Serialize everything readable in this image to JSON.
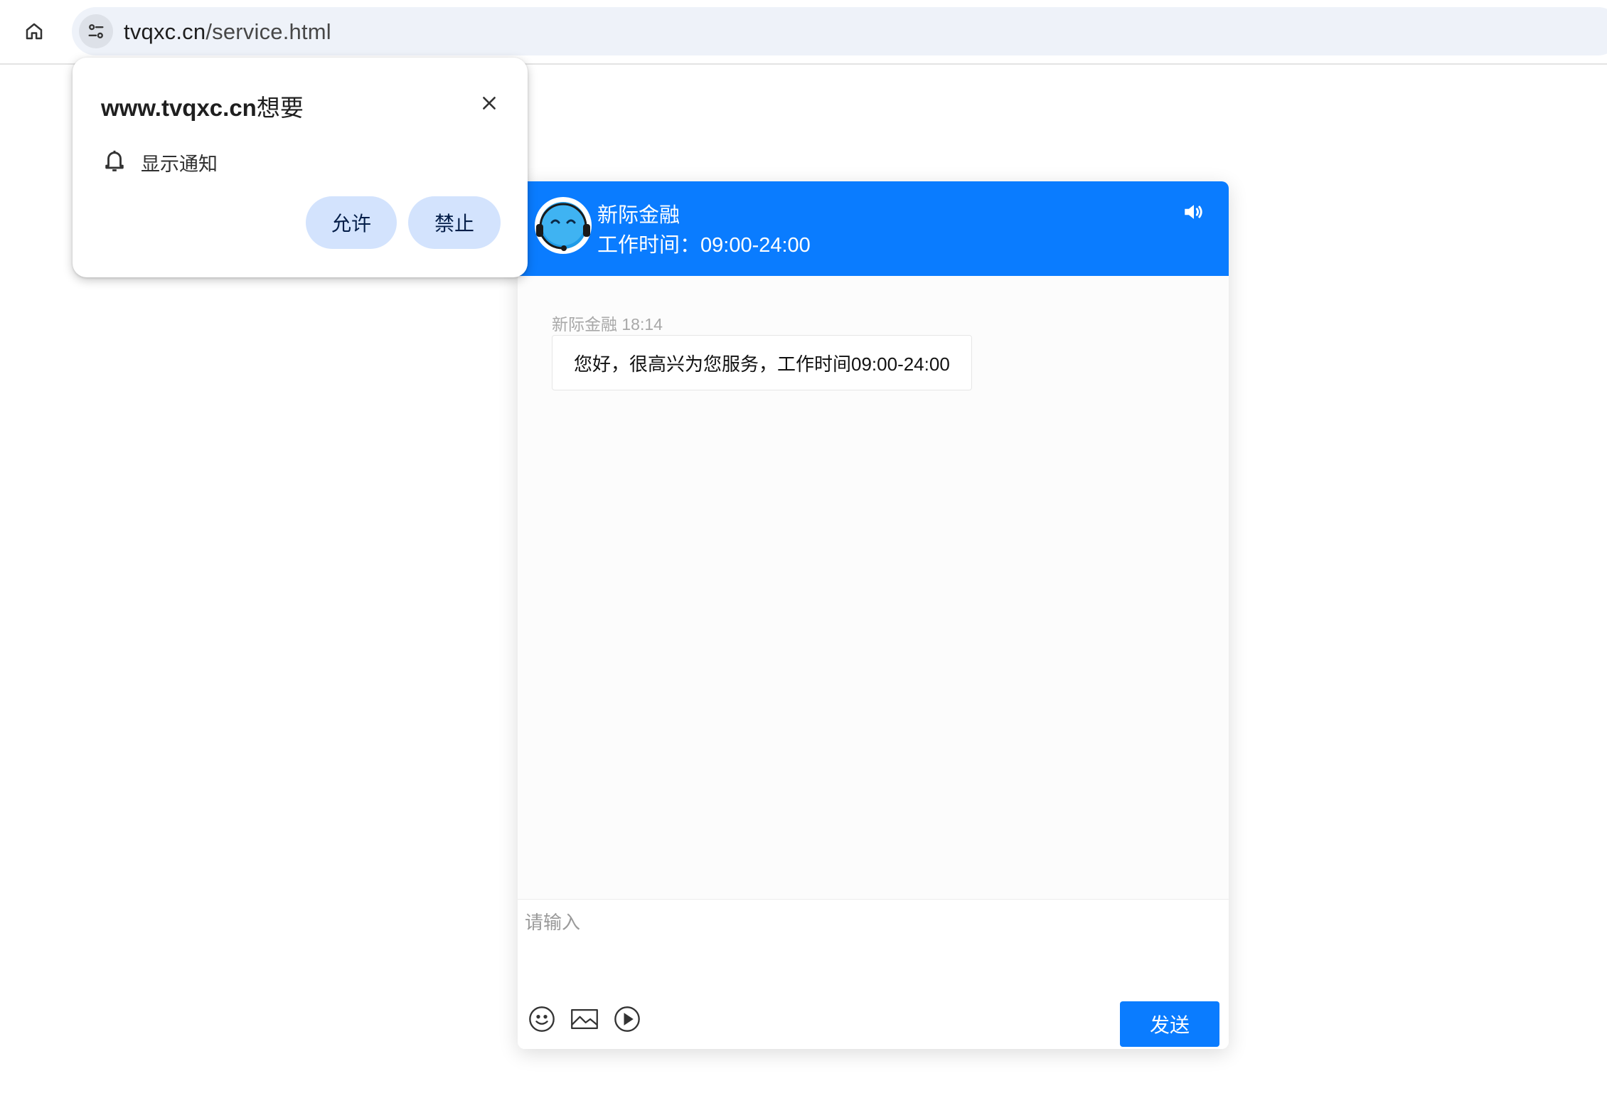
{
  "browser": {
    "url_host": "tvqxc.cn",
    "url_path": "/service.html"
  },
  "permission_popup": {
    "site": "www.tvqxc.cn",
    "wants": "想要",
    "permission_label": "显示通知",
    "allow_label": "允许",
    "block_label": "禁止"
  },
  "chat": {
    "accent_color": "#0a7cff",
    "agent_name": "新际金融",
    "work_hours": "工作时间：09:00-24:00",
    "messages": [
      {
        "sender": "新际金融",
        "time": "18:14",
        "text": "您好，很高兴为您服务，工作时间09:00-24:00"
      }
    ],
    "input_placeholder": "请输入",
    "send_label": "发送",
    "tools": [
      "emoji-icon",
      "image-icon",
      "video-icon"
    ]
  }
}
